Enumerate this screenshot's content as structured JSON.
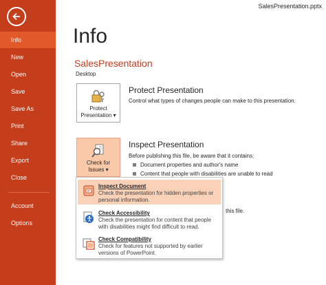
{
  "window": {
    "filename": "SalesPresentation.pptx"
  },
  "sidebar": {
    "items": [
      {
        "label": "Info"
      },
      {
        "label": "New"
      },
      {
        "label": "Open"
      },
      {
        "label": "Save"
      },
      {
        "label": "Save As"
      },
      {
        "label": "Print"
      },
      {
        "label": "Share"
      },
      {
        "label": "Export"
      },
      {
        "label": "Close"
      }
    ],
    "bottom_items": [
      {
        "label": "Account"
      },
      {
        "label": "Options"
      }
    ],
    "active": "Info"
  },
  "main": {
    "title": "Info",
    "doc_name": "SalesPresentation",
    "doc_location": "Desktop",
    "protect": {
      "button_line1": "Protect",
      "button_line2": "Presentation ▾",
      "title": "Protect Presentation",
      "description": "Control what types of changes people can make to this presentation."
    },
    "inspect": {
      "button_line1": "Check for",
      "button_line2": "Issues ▾",
      "title": "Inspect Presentation",
      "description": "Before publishing this file, be aware that it contains:",
      "bullets": [
        "Document properties and author's name",
        "Content that people with disabilities are unable to read"
      ],
      "trailing_text": "this file."
    }
  },
  "dropdown": {
    "items": [
      {
        "title": "Inspect Document",
        "description": "Check the presentation for hidden properties or personal information."
      },
      {
        "title": "Check Accessibility",
        "description": "Check the presentation for content that people with disabilities might find difficult to read."
      },
      {
        "title": "Check Compatibility",
        "description": "Check for features not supported by earlier versions of PowerPoint."
      }
    ]
  },
  "colors": {
    "sidebar": "#c43e1c",
    "sidebar_active": "#e25a2a",
    "accent_text": "#c43e1c",
    "highlight": "#fbd2b8"
  }
}
